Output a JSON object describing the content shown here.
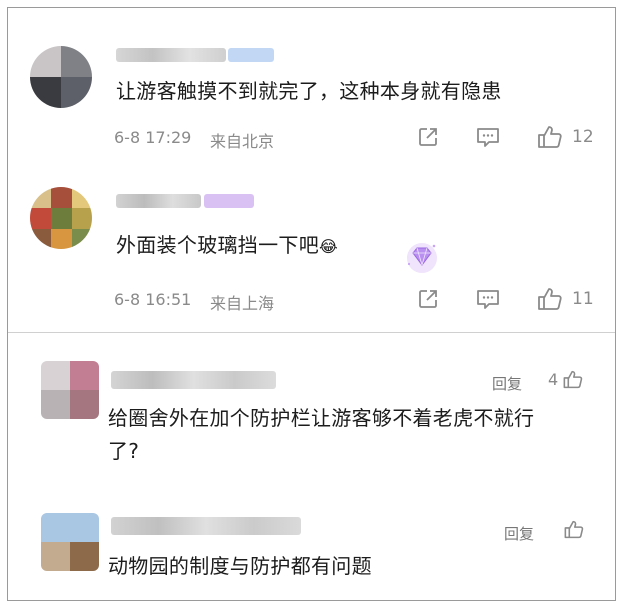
{
  "colors": {
    "text": "#1c1c1c",
    "meta": "#8a8a8a",
    "vip_badge": "#8ab4f8",
    "vip_badge_purple": "#c9a6ef"
  },
  "comments": [
    {
      "text": "让游客触摸不到就完了，这种本身就有隐患",
      "time": "6-8 17:29",
      "location": "来自北京",
      "likes": "12",
      "icons": [
        "share-icon",
        "comment-icon",
        "like-icon"
      ]
    },
    {
      "text": "外面装个玻璃挡一下吧",
      "emoji": "😂",
      "time": "6-8 16:51",
      "location": "来自上海",
      "likes": "11",
      "icons": [
        "share-icon",
        "comment-icon",
        "like-icon"
      ]
    }
  ],
  "replies": [
    {
      "text_line1": "给圈舍外在加个防护栏让游客够不着老虎不就行",
      "text_line2": "了?",
      "reply_label": "回复",
      "likes": "4"
    },
    {
      "text": "动物园的制度与防护都有问题",
      "reply_label": "回复",
      "likes": ""
    }
  ]
}
